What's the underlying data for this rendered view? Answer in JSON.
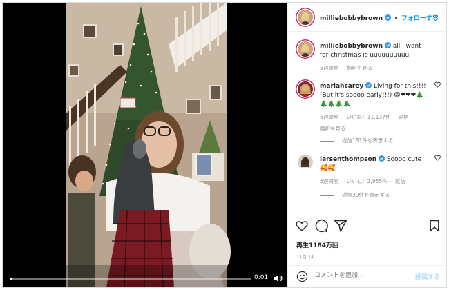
{
  "header": {
    "username": "milliebobbybrown",
    "dot": "•",
    "follow_label": "フォローする",
    "more": "···"
  },
  "caption": {
    "username": "milliebobbybrown",
    "text": "all I want for christmas is uuuuuuuuuu",
    "time": "5週間前",
    "translate": "翻訳を見る"
  },
  "comments": [
    {
      "username": "mariahcarey",
      "text": "Living for this!!!! (But it's soooo early!!!) 😁❤❤❤🎄🎄🎄🎄🎄",
      "time": "5週間前",
      "likes": "いいね！11,137件",
      "reply": "返信",
      "translate": "翻訳を見る",
      "replies": "返信181件を表示する"
    },
    {
      "username": "larsenthompson",
      "text": "Soooo cute 🥰🥰",
      "time": "5週間前",
      "likes": "いいね！2,955件",
      "reply": "返信",
      "replies": "返信39件を表示する"
    }
  ],
  "stats": {
    "views": "再生1184万回",
    "date": "11月 14"
  },
  "add_comment": {
    "placeholder": "コメントを追加...",
    "post_label": "投稿する"
  },
  "video": {
    "time": "0:01",
    "progress": 0.01
  },
  "colors": {
    "accent": "#0095f6",
    "ring": "#d62976",
    "muted": "#8e8e8e"
  }
}
